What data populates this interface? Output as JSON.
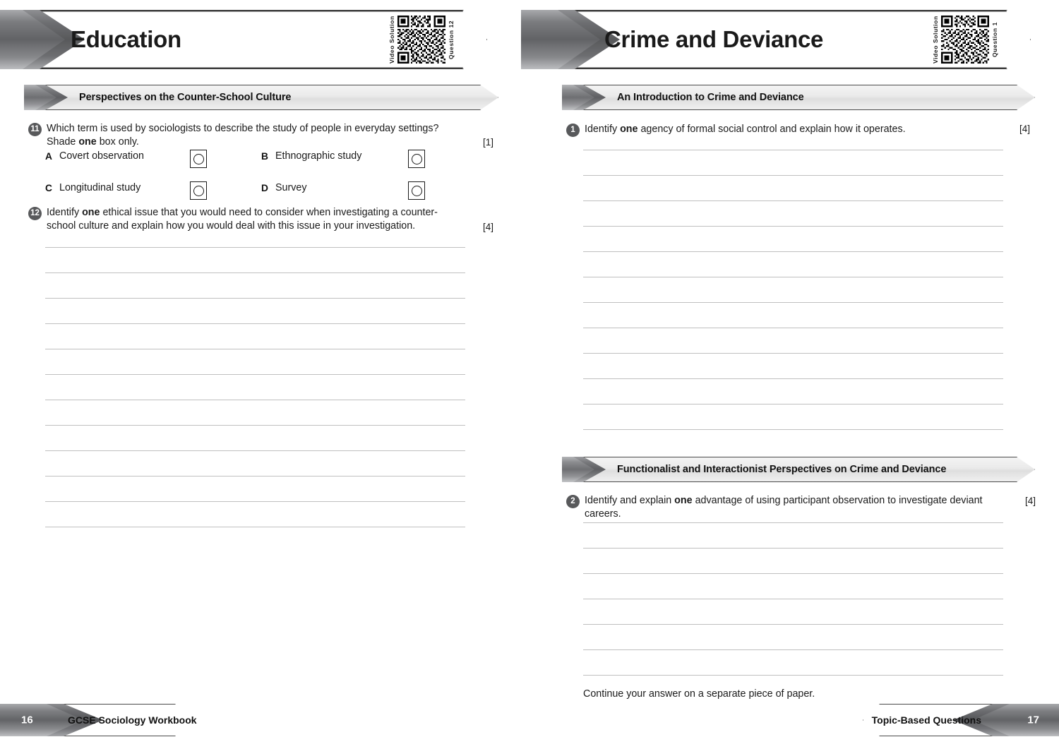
{
  "left_page": {
    "chapter_title": "Education",
    "qr": {
      "left_label": "Video Solution",
      "right_label": "Question 12",
      "icon": "qr-code-icon"
    },
    "section": {
      "title": "Perspectives on the Counter-School Culture"
    },
    "questions": [
      {
        "number": "11",
        "text_line1_a": "Which term is used by sociologists to describe the study of people in everyday settings?",
        "text_line2_a": "Shade ",
        "text_line2_b": "one",
        "text_line2_c": " box only.",
        "marks": "[1]",
        "options": [
          {
            "letter": "A",
            "label": "Covert observation"
          },
          {
            "letter": "B",
            "label": "Ethnographic study"
          },
          {
            "letter": "C",
            "label": "Longitudinal study"
          },
          {
            "letter": "D",
            "label": "Survey"
          }
        ]
      },
      {
        "number": "12",
        "text_a": "Identify ",
        "text_b": "one",
        "text_c": " ethical issue that you would need to consider when investigating a counter-school culture and explain how you would deal with this issue in your investigation.",
        "marks": "[4]",
        "answer_line_count": 12
      }
    ],
    "footer": {
      "page_number": "16",
      "label": "GCSE Sociology Workbook"
    }
  },
  "right_page": {
    "chapter_title": "Crime and Deviance",
    "qr": {
      "left_label": "Video Solution",
      "right_label": "Question 1",
      "icon": "qr-code-icon"
    },
    "sections": [
      {
        "title": "An Introduction to Crime and Deviance",
        "question": {
          "number": "1",
          "text_a": "Identify ",
          "text_b": "one",
          "text_c": " agency of formal social control and explain how it operates.",
          "marks": "[4]",
          "answer_line_count": 12
        }
      },
      {
        "title": "Functionalist and Interactionist Perspectives on Crime and Deviance",
        "question": {
          "number": "2",
          "text_a": "Identify and explain ",
          "text_b": "one",
          "text_c": " advantage of using participant observation to investigate deviant careers.",
          "marks": "[4]",
          "answer_line_count": 7
        }
      }
    ],
    "note": "Continue your answer on a separate piece of paper.",
    "footer": {
      "page_number": "17",
      "label": "Topic-Based Questions"
    }
  },
  "colors": {
    "banner_dark": "#58595b",
    "section_bar_fill": "#eaeaea",
    "rule_line": "#bfbfbf",
    "text": "#1a1a1a",
    "number_badge": "#58595b"
  }
}
